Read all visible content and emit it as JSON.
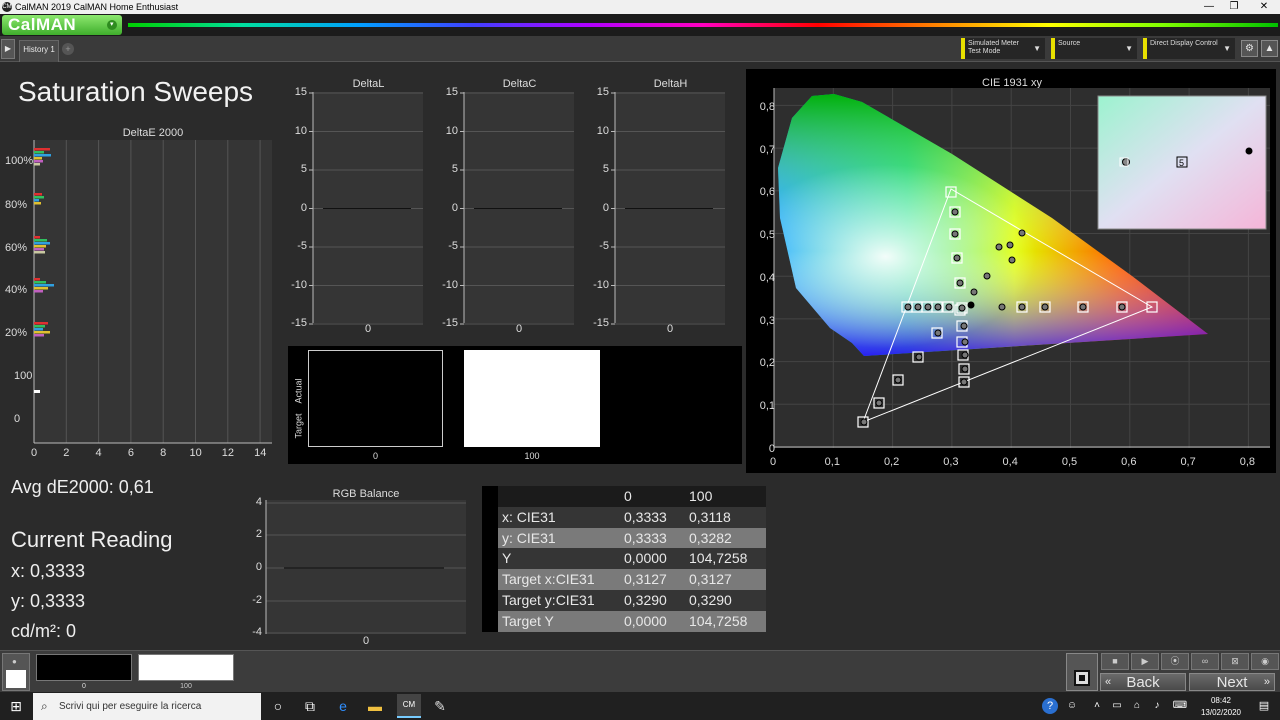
{
  "window": {
    "app_logo": "CM",
    "title": "CalMAN 2019 CalMAN Home Enthusiast",
    "controls": {
      "minimize": "—",
      "restore": "❐",
      "close": "✕"
    }
  },
  "brand": {
    "name": "CalMAN"
  },
  "tabs": {
    "history_label": "History 1",
    "add": "+"
  },
  "toolbar": {
    "meter_line1": "Simulated Meter",
    "meter_line2": "Test Mode",
    "source": "Source",
    "display_control": "Direct Display Control"
  },
  "page_title": "Saturation Sweeps",
  "deltae_chart": {
    "title": "DeltaE 2000",
    "ylabels": [
      "100%",
      "80%",
      "60%",
      "40%",
      "20%",
      "100",
      "0"
    ],
    "xlabels": [
      "0",
      "2",
      "4",
      "6",
      "8",
      "10",
      "12",
      "14"
    ]
  },
  "delta_charts": [
    {
      "title": "DeltaL",
      "xlabel": "0"
    },
    {
      "title": "DeltaC",
      "xlabel": "0"
    },
    {
      "title": "DeltaH",
      "xlabel": "0"
    }
  ],
  "delta_ylabels": [
    "15",
    "10",
    "5",
    "0",
    "-5",
    "-10",
    "-15"
  ],
  "swatch_panel": {
    "actual_label": "Actual",
    "target_label": "Target",
    "swatches": [
      {
        "label": "0",
        "color": "#000000"
      },
      {
        "label": "100",
        "color": "#ffffff"
      }
    ]
  },
  "cie_chart": {
    "title": "CIE 1931 xy",
    "xlabels": [
      "0",
      "0,1",
      "0,2",
      "0,3",
      "0,4",
      "0,5",
      "0,6",
      "0,7",
      "0,8"
    ],
    "ylabels": [
      "0,8",
      "0,7",
      "0,6",
      "0,5",
      "0,4",
      "0,3",
      "0,2",
      "0,1",
      "0"
    ],
    "inset_label": "5"
  },
  "avg_de": "Avg dE2000: 0,61",
  "current": {
    "heading": "Current Reading",
    "x": "x: 0,3333",
    "y": "y: 0,3333",
    "cd": "cd/m²: 0"
  },
  "rgb_chart": {
    "title": "RGB Balance",
    "ylabels": [
      "4",
      "2",
      "0",
      "-2",
      "-4"
    ],
    "xlabel": "0"
  },
  "readings_table": {
    "header": [
      "",
      "0",
      "100"
    ],
    "rows": [
      [
        "x: CIE31",
        "0,3333",
        "0,3118"
      ],
      [
        "y: CIE31",
        "0,3333",
        "0,3282"
      ],
      [
        "Y",
        "0,0000",
        "104,7258"
      ],
      [
        "Target x:CIE31",
        "0,3127",
        "0,3127"
      ],
      [
        "Target y:CIE31",
        "0,3290",
        "0,3290"
      ],
      [
        "Target Y",
        "0,0000",
        "104,7258"
      ]
    ]
  },
  "bottom": {
    "thumb1_label": "0",
    "thumb2_label": "100",
    "back": "Back",
    "next": "Next"
  },
  "taskbar": {
    "search_placeholder": "Scrivi qui per eseguire la ricerca",
    "time": "08:42",
    "date": "13/02/2020"
  }
}
